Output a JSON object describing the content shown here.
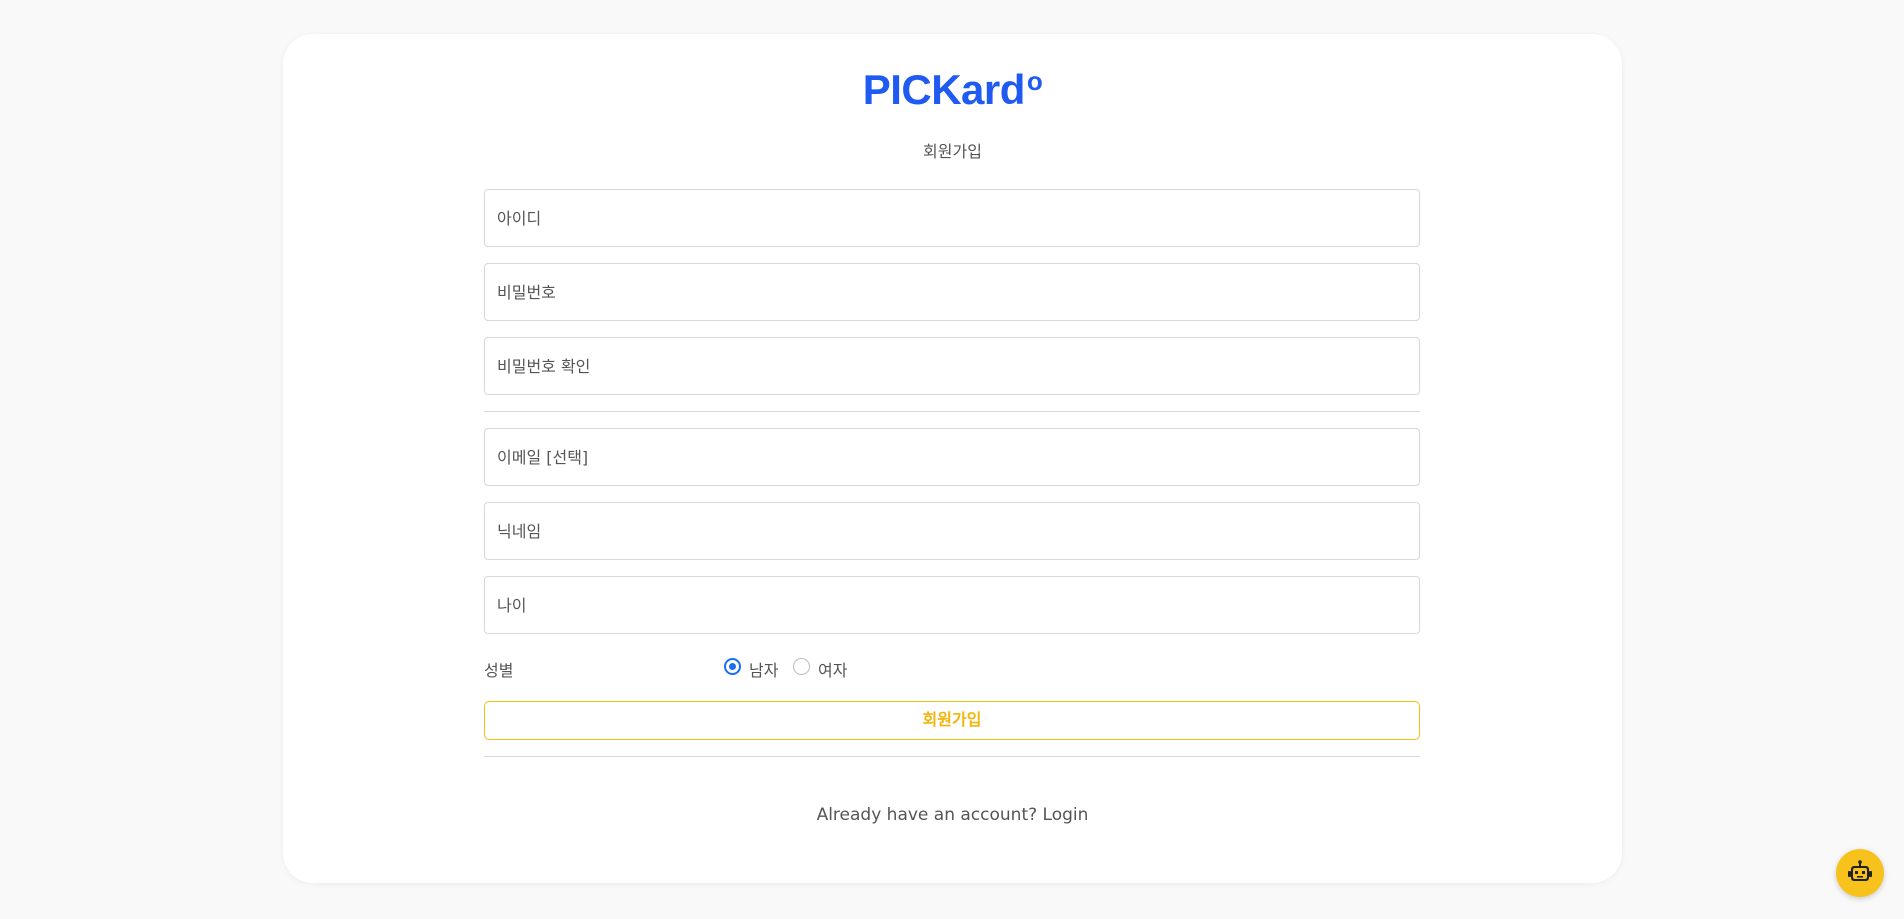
{
  "logo": {
    "text": "PICKard",
    "mark": "o"
  },
  "subtitle": "회원가입",
  "fields": {
    "username_placeholder": "아이디",
    "password_placeholder": "비밀번호",
    "password_confirm_placeholder": "비밀번호 확인",
    "email_placeholder": "이메일 [선택]",
    "nickname_placeholder": "닉네임",
    "age_placeholder": "나이"
  },
  "gender": {
    "label": "성별",
    "options": [
      "남자",
      "여자"
    ],
    "selected": "남자"
  },
  "submit_label": "회원가입",
  "login_prompt": "Already have an account? Login",
  "chatbot": {
    "icon": "robot-icon"
  },
  "colors": {
    "brand_blue": "#1f5bf0",
    "accent_yellow": "#f3c21a",
    "radio_blue": "#1b6ef3"
  }
}
